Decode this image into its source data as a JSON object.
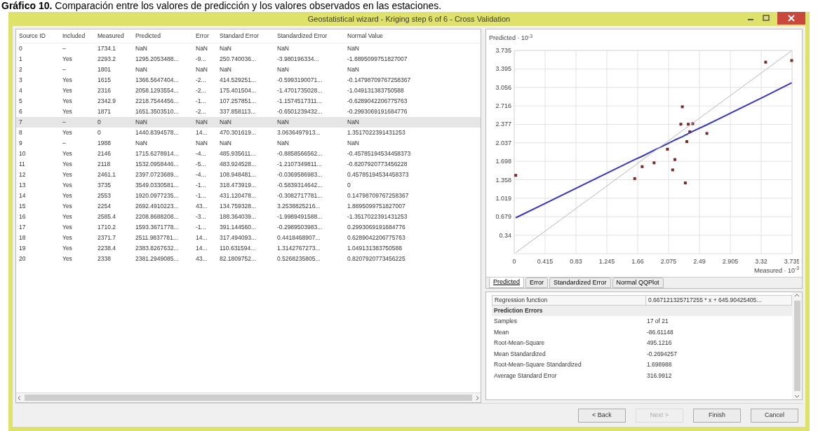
{
  "caption": "**Gráfico 10.** Comparación entre los valores de predicción y los valores observados en las estaciones.",
  "window": {
    "title": "Geostatistical wizard - Kriging step 6 of 6 - Cross Validation"
  },
  "table": {
    "columns": [
      "Source ID",
      "Included",
      "Measured",
      "Predicted",
      "Error",
      "Standard Error",
      "Standardized Error",
      "Normal Value"
    ],
    "rows": [
      {
        "selected": false,
        "cells": [
          "0",
          "–",
          "1734.1",
          "NaN",
          "NaN",
          "NaN",
          "NaN",
          "NaN"
        ]
      },
      {
        "selected": false,
        "cells": [
          "1",
          "Yes",
          "2293.2",
          "1295.2053488...",
          "-9...",
          "250.740036...",
          "-3.980196334...",
          "-1.8895099751827007"
        ]
      },
      {
        "selected": false,
        "cells": [
          "2",
          "–",
          "1801",
          "NaN",
          "NaN",
          "NaN",
          "NaN",
          "NaN"
        ]
      },
      {
        "selected": false,
        "cells": [
          "3",
          "Yes",
          "1615",
          "1366.5647404...",
          "-2...",
          "414.529251...",
          "-0.5993190071...",
          "-0.14798709767258367"
        ]
      },
      {
        "selected": false,
        "cells": [
          "4",
          "Yes",
          "2316",
          "2058.1293554...",
          "-2...",
          "175.401504...",
          "-1.4701735028...",
          "-1.049131383750588"
        ]
      },
      {
        "selected": false,
        "cells": [
          "5",
          "Yes",
          "2342.9",
          "2218.7544456...",
          "-1...",
          "107.257851...",
          "-1.1574517311...",
          "-0.6289042206775763"
        ]
      },
      {
        "selected": false,
        "cells": [
          "6",
          "Yes",
          "1871",
          "1651.3503510...",
          "-2...",
          "337.858113...",
          "-0.6501239432...",
          "-0.2993069191684776"
        ]
      },
      {
        "selected": true,
        "cells": [
          "7",
          "–",
          "0",
          "NaN",
          "NaN",
          "NaN",
          "NaN",
          "NaN"
        ]
      },
      {
        "selected": false,
        "cells": [
          "8",
          "Yes",
          "0",
          "1440.8394578...",
          "14...",
          "470.301619...",
          "3.0636497913...",
          "1.3517022391431253"
        ]
      },
      {
        "selected": false,
        "cells": [
          "9",
          "–",
          "1988",
          "NaN",
          "NaN",
          "NaN",
          "NaN",
          "NaN"
        ]
      },
      {
        "selected": false,
        "cells": [
          "10",
          "Yes",
          "2146",
          "1715.6278914...",
          "-4...",
          "485.935611...",
          "-0.8858566562...",
          "-0.45785194534458373"
        ]
      },
      {
        "selected": false,
        "cells": [
          "11",
          "Yes",
          "2118",
          "1532.0958446...",
          "-5...",
          "483.924528...",
          "-1.2107349811...",
          "-0.8207920773456228"
        ]
      },
      {
        "selected": false,
        "cells": [
          "12",
          "Yes",
          "2461.1",
          "2397.0723689...",
          "-4...",
          "108.948481...",
          "-0.0369586983...",
          "0.45785194534458373"
        ]
      },
      {
        "selected": false,
        "cells": [
          "13",
          "Yes",
          "3735",
          "3549.0330581...",
          "-1...",
          "318.473919...",
          "-0.5839314642...",
          "0"
        ]
      },
      {
        "selected": false,
        "cells": [
          "14",
          "Yes",
          "2553",
          "1920.0977235...",
          "-1...",
          "431.120478...",
          "-0.3082717781...",
          "0.14798709767258367"
        ]
      },
      {
        "selected": false,
        "cells": [
          "15",
          "Yes",
          "2254",
          "2692.4910223...",
          "43...",
          "134.759328...",
          "3.2538825216...",
          "1.8895099751827007"
        ]
      },
      {
        "selected": false,
        "cells": [
          "16",
          "Yes",
          "2585.4",
          "2208.8688208...",
          "-3...",
          "188.364039...",
          "-1.9989491588...",
          "-1.3517022391431253"
        ]
      },
      {
        "selected": false,
        "cells": [
          "17",
          "Yes",
          "1710.2",
          "1593.3671778...",
          "-1...",
          "391.144560...",
          "-0.2989503983...",
          "0.2993069191684776"
        ]
      },
      {
        "selected": false,
        "cells": [
          "18",
          "Yes",
          "2371.7",
          "2511.9837781...",
          "14...",
          "317.494093...",
          "0.4418468907...",
          "0.6289042206775763"
        ]
      },
      {
        "selected": false,
        "cells": [
          "19",
          "Yes",
          "2238.4",
          "2383.8267632...",
          "14...",
          "110.631594...",
          "1.3142767273...",
          "1.049131383750588"
        ]
      },
      {
        "selected": false,
        "cells": [
          "20",
          "Yes",
          "2338",
          "2381.2949085...",
          "43...",
          "82.1809752...",
          "0.5268235805...",
          "0.8207920773456225"
        ]
      }
    ]
  },
  "chart": {
    "ylabel": "Predicted · 10$^{-3}$",
    "xlabel": "Measured · 10$^{-3}$",
    "chart_data": {
      "type": "scatter",
      "grid": true,
      "xlim": [
        0,
        3.735
      ],
      "ylim": [
        0,
        3.735
      ],
      "xticks": [
        0,
        0.415,
        0.83,
        1.245,
        1.66,
        2.075,
        2.49,
        2.905,
        3.32,
        3.735
      ],
      "yticks": [
        0.34,
        0.679,
        1.019,
        1.358,
        1.698,
        2.037,
        2.377,
        2.716,
        3.056,
        3.395,
        3.735
      ],
      "x": [
        0.02,
        1.62,
        1.72,
        1.88,
        2.06,
        2.13,
        2.16,
        2.24,
        2.26,
        2.3,
        2.32,
        2.34,
        2.36,
        2.4,
        2.59,
        3.38,
        3.73
      ],
      "series": [
        {
          "type": "scatter",
          "color": "#7a2a2a",
          "values": [
            1.44,
            1.38,
            1.6,
            1.67,
            1.92,
            1.54,
            1.73,
            2.38,
            2.7,
            1.3,
            2.06,
            2.38,
            2.24,
            2.39,
            2.21,
            3.52,
            3.55
          ]
        },
        {
          "type": "line",
          "color": "#3535d0",
          "values": [
            0.66,
            1.73,
            1.79,
            1.9,
            2.02,
            2.07,
            2.09,
            2.14,
            2.15,
            2.18,
            2.19,
            2.21,
            2.22,
            2.25,
            2.37,
            2.9,
            3.14
          ]
        },
        {
          "type": "line",
          "color": "#b8b8b8",
          "values": [
            0.02,
            1.62,
            1.72,
            1.88,
            2.06,
            2.13,
            2.16,
            2.24,
            2.26,
            2.3,
            2.32,
            2.34,
            2.36,
            2.4,
            2.59,
            3.38,
            3.73
          ]
        }
      ]
    }
  },
  "chart_tabs": [
    {
      "label": "Predicted",
      "selected": true
    },
    {
      "label": "Error",
      "selected": false
    },
    {
      "label": "Standardized Error",
      "selected": false
    },
    {
      "label": "Normal QQPlot",
      "selected": false
    }
  ],
  "stats": {
    "regression": {
      "label": "Regression function",
      "value": "0.667121325717255 * x + 645.90425405..."
    },
    "section": "Prediction Errors",
    "rows": [
      {
        "label": "Samples",
        "value": "17 of 21"
      },
      {
        "label": "Mean",
        "value": "-86.61148"
      },
      {
        "label": "Root-Mean-Square",
        "value": "495.1216"
      },
      {
        "label": "Mean Standardized",
        "value": "-0.2694257"
      },
      {
        "label": "Root-Mean-Square Standardized",
        "value": "1.698988"
      },
      {
        "label": "Average Standard Error",
        "value": "316.9912"
      }
    ]
  },
  "buttons": [
    {
      "label": "< Back",
      "disabled": false
    },
    {
      "label": "Next >",
      "disabled": true
    },
    {
      "label": "Finish",
      "disabled": false
    },
    {
      "label": "Cancel",
      "disabled": false
    }
  ]
}
